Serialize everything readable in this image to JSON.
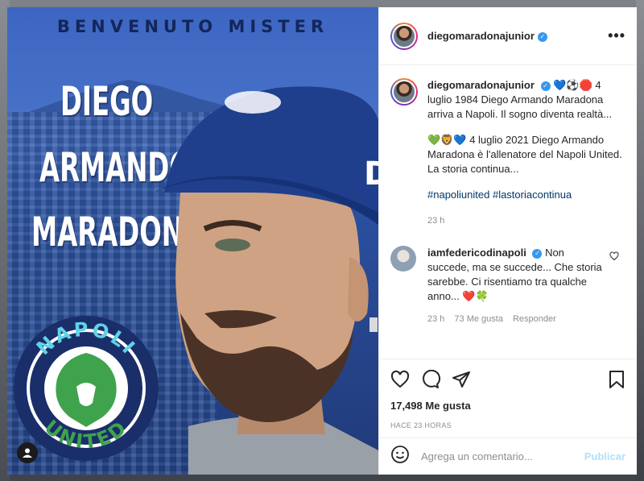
{
  "post": {
    "username": "diegomaradonajunior",
    "verified_mark": "✓",
    "more_icon": "more-horizontal-icon"
  },
  "image": {
    "headline": "BENVENUTO MISTER",
    "name_lines": [
      "DIEGO",
      "ARMANDO",
      "MARADONA"
    ],
    "badge_top": "NAPOLI",
    "badge_bottom": "UNITED",
    "user_icon": "person-icon"
  },
  "caption": {
    "username": "diegomaradonajunior",
    "emoji_1": "💙⚽🛑",
    "text_1": "4 luglio 1984 Diego Armando Maradona arriva a Napoli. Il sogno diventa realtà...",
    "emoji_2": "💚🦁💙",
    "text_2": "4 luglio 2021 Diego Armando Maradona è l'allenatore del Napoli United. La storia continua...",
    "hashtags": "#napoliunited #lastoriacontinua",
    "time": "23 h"
  },
  "comment": {
    "username": "iamfedericodinapoli",
    "text": "Non succede, ma se succede... Che storia sarebbe. Ci risentiamo tra qualche anno...",
    "emoji": "❤️🍀",
    "time": "23 h",
    "likes": "73 Me gusta",
    "reply": "Responder"
  },
  "actions": {
    "likes": "17,498 Me gusta",
    "timestamp": "HACE 23 HORAS"
  },
  "composer": {
    "placeholder": "Agrega un comentario...",
    "publish": "Publicar"
  },
  "colors": {
    "link": "#00376b",
    "verified": "#3897f0",
    "publish_disabled": "#b2dffc",
    "poster_blue": "#2f58b0",
    "badge_green": "#3fa34d"
  }
}
